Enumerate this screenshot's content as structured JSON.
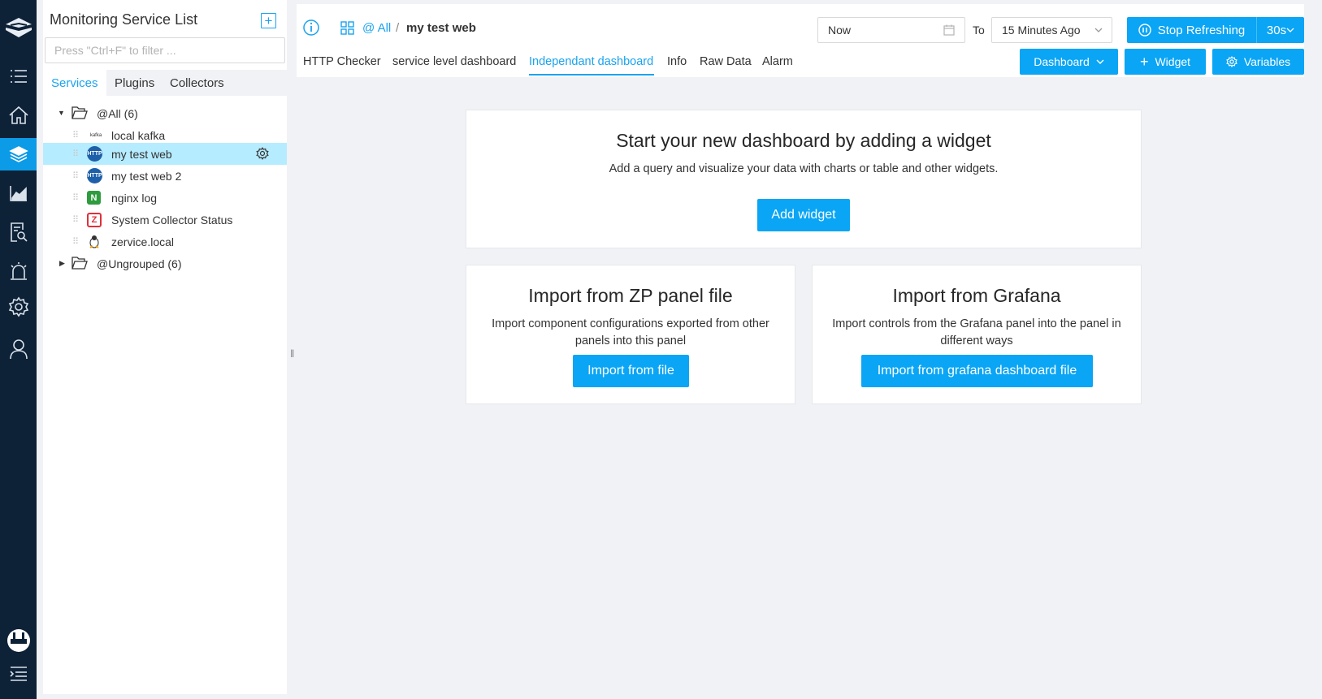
{
  "sidebar_rail": {
    "icons": [
      "logo-icon",
      "list-icon",
      "home-icon",
      "layers-icon",
      "chart-icon",
      "report-search-icon",
      "alarm-icon",
      "settings-icon",
      "user-icon",
      "support-icon",
      "menu-collapse-icon"
    ]
  },
  "service_panel": {
    "title": "Monitoring Service List",
    "filter_placeholder": "Press \"Ctrl+F\" to filter ...",
    "tabs": [
      {
        "label": "Services",
        "active": true
      },
      {
        "label": "Plugins",
        "active": false
      },
      {
        "label": "Collectors",
        "active": false
      }
    ],
    "tree": {
      "group_all": "@All (6)",
      "items": [
        {
          "label": "local kafka",
          "icon": "kafka-icon"
        },
        {
          "label": "my test web",
          "icon": "http-icon",
          "selected": true
        },
        {
          "label": "my test web 2",
          "icon": "http-icon"
        },
        {
          "label": "nginx log",
          "icon": "nginx-icon"
        },
        {
          "label": "System Collector Status",
          "icon": "zervice-collector-icon"
        },
        {
          "label": "zervice.local",
          "icon": "linux-icon"
        }
      ],
      "group_ungrouped": "@Ungrouped (6)"
    },
    "http_icon_text": "HTTP",
    "nginx_icon_text": "N",
    "kafka_icon_text": "kafka",
    "zervice_icon_text": "Z"
  },
  "header": {
    "breadcrumb_all": "@ All",
    "breadcrumb_sep": "/",
    "breadcrumb_current": "my test web",
    "date_from": "Now",
    "to_label": "To",
    "date_to": "15 Minutes Ago",
    "stop_refreshing": "Stop Refreshing",
    "interval": "30s",
    "tabs": [
      {
        "label": "HTTP Checker",
        "active": false
      },
      {
        "label": "service level dashboard",
        "active": false
      },
      {
        "label": "Independant dashboard",
        "active": true
      },
      {
        "label": "Info",
        "active": false
      },
      {
        "label": "Raw Data",
        "active": false
      },
      {
        "label": "Alarm",
        "active": false
      }
    ],
    "dashboard_btn": "Dashboard",
    "widget_btn": "Widget",
    "variables_btn": "Variables"
  },
  "main": {
    "start_card": {
      "title": "Start your new dashboard by adding a widget",
      "desc": "Add a query and visualize your data with charts or table and other widgets.",
      "button": "Add widget"
    },
    "zp_card": {
      "title": "Import from ZP panel file",
      "desc": "Import component configurations exported from other panels into this panel",
      "button": "Import from file"
    },
    "grafana_card": {
      "title": "Import from Grafana",
      "desc": "Import controls from the Grafana panel into the panel in different ways",
      "button": "Import from grafana dashboard file"
    }
  },
  "colors": {
    "accent": "#0aa5f5",
    "rail_bg": "#0d2137",
    "selected_row": "#b6ecff"
  }
}
